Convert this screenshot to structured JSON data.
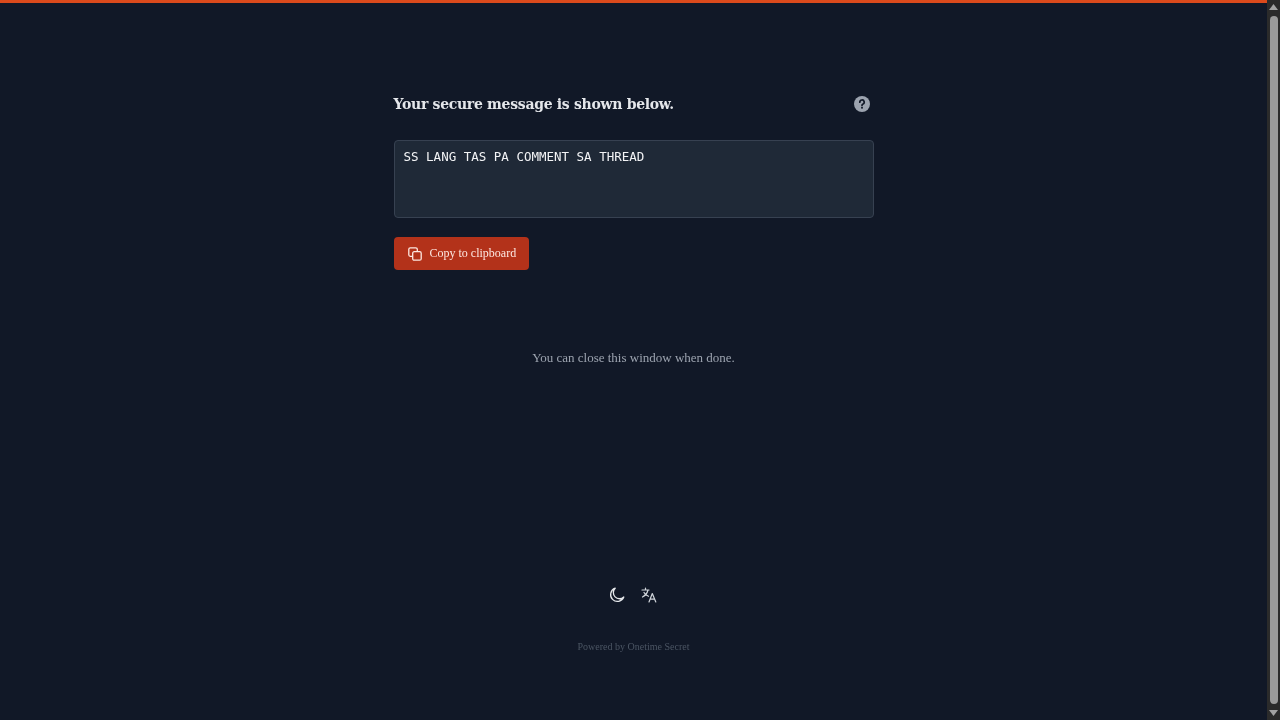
{
  "header": {
    "title": "Your secure message is shown below."
  },
  "message": {
    "value": "SS LANG TAS PA COMMENT SA THREAD"
  },
  "copy_button": {
    "label": "Copy to clipboard"
  },
  "note": "You can close this window when done.",
  "footer": {
    "powered_by": "Powered by Onetime Secret"
  }
}
